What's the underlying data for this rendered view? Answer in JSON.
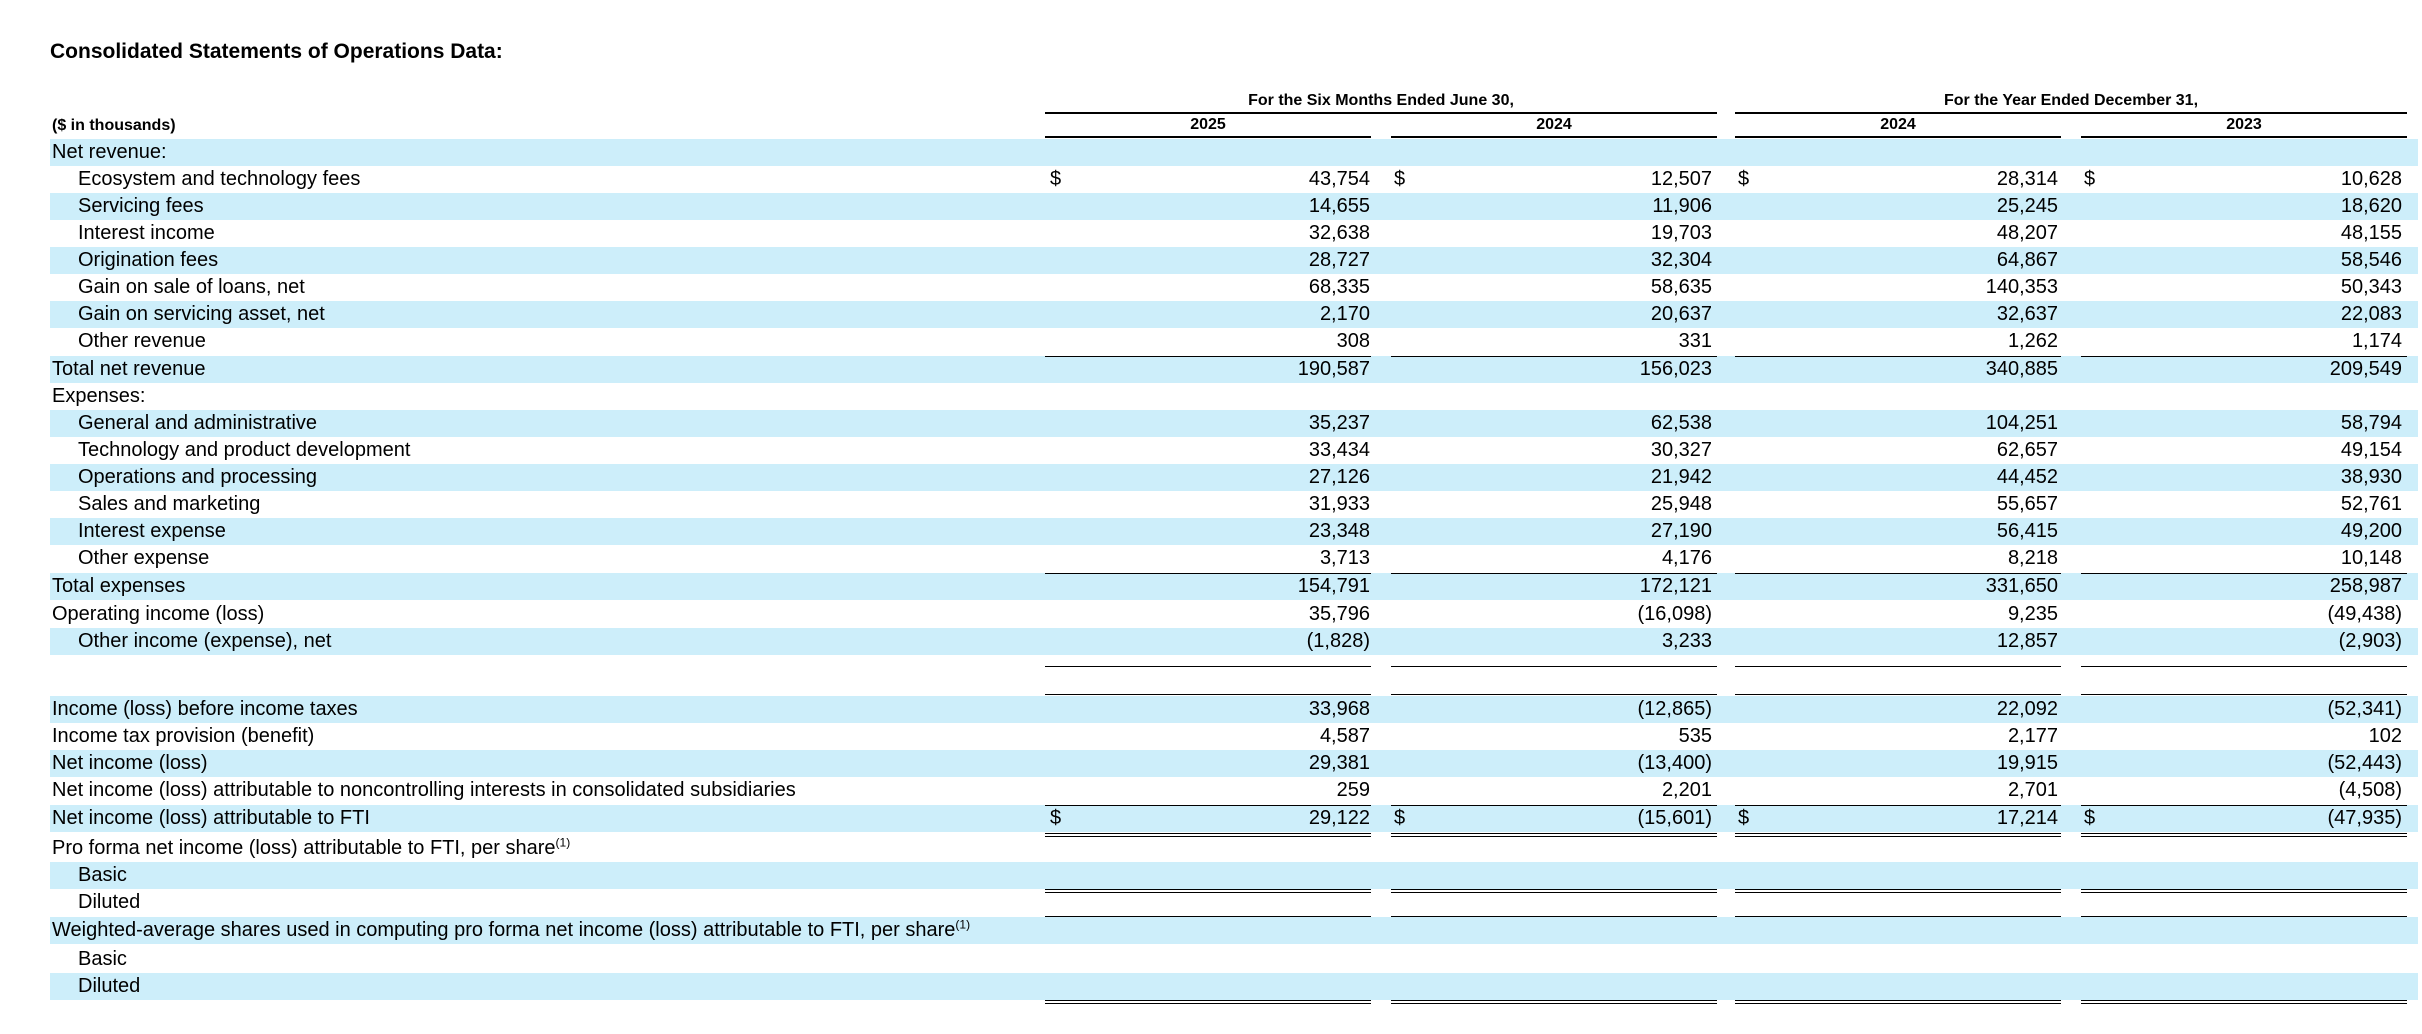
{
  "title": "Consolidated Statements of Operations Data:",
  "unit_label": "($ in thousands)",
  "period_groups": [
    {
      "label": "For the Six Months Ended June 30,"
    },
    {
      "label": "For the Year Ended December 31,"
    }
  ],
  "columns": [
    {
      "year": "2025"
    },
    {
      "year": "2024"
    },
    {
      "year": "2024"
    },
    {
      "year": "2023"
    }
  ],
  "currency_symbol": "$",
  "rows": [
    {
      "label": "Net revenue:",
      "indent": 0,
      "values": [
        "",
        "",
        "",
        ""
      ]
    },
    {
      "label": "Ecosystem and technology fees",
      "indent": 1,
      "values": [
        "43,754",
        "12,507",
        "28,314",
        "10,628"
      ],
      "dollar": true
    },
    {
      "label": "Servicing fees",
      "indent": 1,
      "values": [
        "14,655",
        "11,906",
        "25,245",
        "18,620"
      ]
    },
    {
      "label": "Interest income",
      "indent": 1,
      "values": [
        "32,638",
        "19,703",
        "48,207",
        "48,155"
      ]
    },
    {
      "label": "Origination fees",
      "indent": 1,
      "values": [
        "28,727",
        "32,304",
        "64,867",
        "58,546"
      ]
    },
    {
      "label": "Gain on sale of loans, net",
      "indent": 1,
      "values": [
        "68,335",
        "58,635",
        "140,353",
        "50,343"
      ]
    },
    {
      "label": "Gain on servicing asset, net",
      "indent": 1,
      "values": [
        "2,170",
        "20,637",
        "32,637",
        "22,083"
      ]
    },
    {
      "label": "Other revenue",
      "indent": 1,
      "values": [
        "308",
        "331",
        "1,262",
        "1,174"
      ]
    },
    {
      "label": "Total net revenue",
      "indent": 0,
      "values": [
        "190,587",
        "156,023",
        "340,885",
        "209,549"
      ],
      "border_top": true
    },
    {
      "label": "Expenses:",
      "indent": 0,
      "values": [
        "",
        "",
        "",
        ""
      ]
    },
    {
      "label": "General and administrative",
      "indent": 1,
      "values": [
        "35,237",
        "62,538",
        "104,251",
        "58,794"
      ]
    },
    {
      "label": "Technology and product development",
      "indent": 1,
      "values": [
        "33,434",
        "30,327",
        "62,657",
        "49,154"
      ]
    },
    {
      "label": "Operations and processing",
      "indent": 1,
      "values": [
        "27,126",
        "21,942",
        "44,452",
        "38,930"
      ]
    },
    {
      "label": "Sales and marketing",
      "indent": 1,
      "values": [
        "31,933",
        "25,948",
        "55,657",
        "52,761"
      ]
    },
    {
      "label": "Interest expense",
      "indent": 1,
      "values": [
        "23,348",
        "27,190",
        "56,415",
        "49,200"
      ]
    },
    {
      "label": "Other expense",
      "indent": 1,
      "values": [
        "3,713",
        "4,176",
        "8,218",
        "10,148"
      ]
    },
    {
      "label": "Total expenses",
      "indent": 0,
      "values": [
        "154,791",
        "172,121",
        "331,650",
        "258,987"
      ],
      "border_top": true
    },
    {
      "label": "Operating income (loss)",
      "indent": 0,
      "values": [
        "35,796",
        "(16,098)",
        "9,235",
        "(49,438)"
      ]
    },
    {
      "label": "Other income (expense), net",
      "indent": 1,
      "values": [
        "(1,828)",
        "3,233",
        "12,857",
        "(2,903)"
      ]
    },
    {
      "label": "",
      "indent": 0,
      "values": [
        "",
        "",
        "",
        ""
      ],
      "border_top": true,
      "border_bottom": true
    },
    {
      "label": "Income (loss) before income taxes",
      "indent": 0,
      "values": [
        "33,968",
        "(12,865)",
        "22,092",
        "(52,341)"
      ]
    },
    {
      "label": "Income tax provision (benefit)",
      "indent": 0,
      "values": [
        "4,587",
        "535",
        "2,177",
        "102"
      ]
    },
    {
      "label": "Net income (loss)",
      "indent": 0,
      "values": [
        "29,381",
        "(13,400)",
        "19,915",
        "(52,443)"
      ]
    },
    {
      "label": "Net income (loss) attributable to noncontrolling interests in consolidated subsidiaries",
      "indent": 0,
      "values": [
        "259",
        "2,201",
        "2,701",
        "(4,508)"
      ]
    },
    {
      "label": "Net income (loss) attributable to FTI",
      "indent": 0,
      "values": [
        "29,122",
        "(15,601)",
        "17,214",
        "(47,935)"
      ],
      "dollar": true,
      "border_top": true,
      "double_bottom": true
    },
    {
      "label": "Pro forma net income (loss) attributable to FTI, per share",
      "sup": "(1)",
      "indent": 0,
      "values": [
        "",
        "",
        "",
        ""
      ]
    },
    {
      "label": "Basic",
      "indent": 1,
      "values": [
        "",
        "",
        "",
        ""
      ],
      "double_bottom": true
    },
    {
      "label": "Diluted",
      "indent": 1,
      "values": [
        "",
        "",
        "",
        ""
      ],
      "double_bottom": true
    },
    {
      "label": "Weighted-average shares used in computing pro forma net income (loss) attributable to FTI, per share",
      "sup": "(1)",
      "indent": 0,
      "values": [
        "",
        "",
        "",
        ""
      ]
    },
    {
      "label": "Basic",
      "indent": 1,
      "values": [
        "",
        "",
        "",
        ""
      ],
      "double_bottom": true
    },
    {
      "label": "Diluted",
      "indent": 1,
      "values": [
        "",
        "",
        "",
        ""
      ],
      "double_bottom": true
    }
  ]
}
